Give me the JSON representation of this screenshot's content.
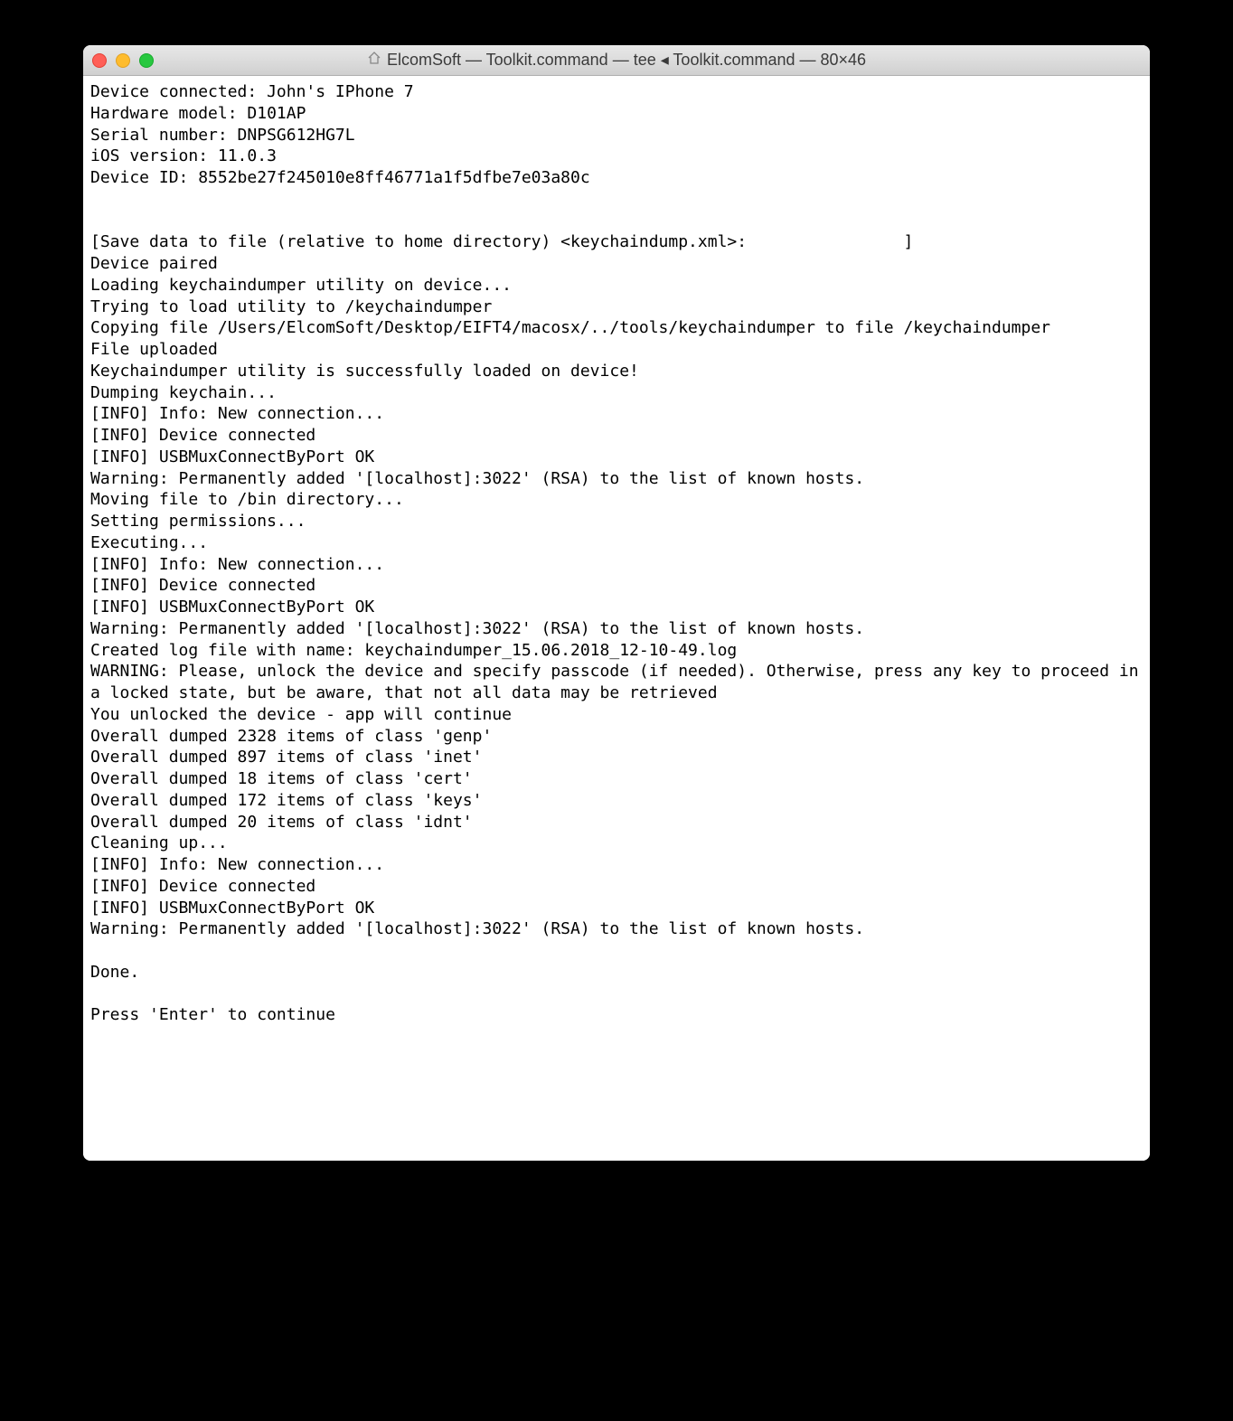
{
  "window": {
    "title": "ElcomSoft — Toolkit.command — tee ◂ Toolkit.command — 80×46"
  },
  "terminal": {
    "lines": [
      "Device connected: John's IPhone 7",
      "Hardware model: D101AP",
      "Serial number: DNPSG612HG7L",
      "iOS version: 11.0.3",
      "Device ID: 8552be27f245010e8ff46771a1f5dfbe7e03a80c",
      "",
      "",
      "[Save data to file (relative to home directory) <keychaindump.xml>:                ]",
      "Device paired",
      "Loading keychaindumper utility on device...",
      "Trying to load utility to /keychaindumper",
      "Copying file /Users/ElcomSoft/Desktop/EIFT4/macosx/../tools/keychaindumper to file /keychaindumper",
      "File uploaded",
      "Keychaindumper utility is successfully loaded on device!",
      "Dumping keychain...",
      "[INFO] Info: New connection...",
      "[INFO] Device connected",
      "[INFO] USBMuxConnectByPort OK",
      "Warning: Permanently added '[localhost]:3022' (RSA) to the list of known hosts.",
      "Moving file to /bin directory...",
      "Setting permissions...",
      "Executing...",
      "[INFO] Info: New connection...",
      "[INFO] Device connected",
      "[INFO] USBMuxConnectByPort OK",
      "Warning: Permanently added '[localhost]:3022' (RSA) to the list of known hosts.",
      "Created log file with name: keychaindumper_15.06.2018_12-10-49.log",
      "WARNING: Please, unlock the device and specify passcode (if needed). Otherwise, press any key to proceed in a locked state, but be aware, that not all data may be retrieved",
      "You unlocked the device - app will continue",
      "Overall dumped 2328 items of class 'genp'",
      "Overall dumped 897 items of class 'inet'",
      "Overall dumped 18 items of class 'cert'",
      "Overall dumped 172 items of class 'keys'",
      "Overall dumped 20 items of class 'idnt'",
      "Cleaning up...",
      "[INFO] Info: New connection...",
      "[INFO] Device connected",
      "[INFO] USBMuxConnectByPort OK",
      "Warning: Permanently added '[localhost]:3022' (RSA) to the list of known hosts.",
      "",
      "Done.",
      "",
      "Press 'Enter' to continue"
    ]
  }
}
